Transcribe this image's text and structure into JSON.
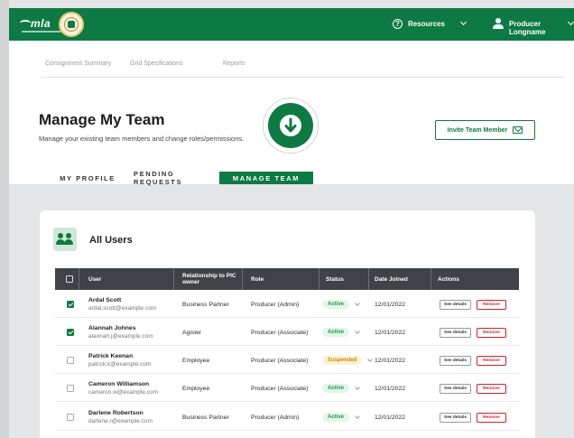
{
  "header": {
    "logo_text": "mla",
    "resources_label": "Resources",
    "user_label": "Producer Longname"
  },
  "subnav": {
    "items": [
      "Consignment Summary",
      "Grid Specifications",
      "Reports"
    ]
  },
  "page": {
    "title": "Manage My Team",
    "subtitle": "Manage your existing team members and change roles/permissions.",
    "invite_label": "Invite Team Member"
  },
  "tabs": [
    {
      "label": "MY PROFILE",
      "active": false
    },
    {
      "label": "PENDING REQUESTS",
      "active": false
    },
    {
      "label": "MANAGE TEAM",
      "active": true
    }
  ],
  "card": {
    "title": "All Users"
  },
  "table": {
    "columns": [
      "User",
      "Relationship to PIC owner",
      "Role",
      "Status",
      "Date Joined",
      "Actions"
    ],
    "see_details_label": "See details",
    "remove_label": "Remove",
    "rows": [
      {
        "name": "Ardal Scott",
        "email": "ardal.scott@example.com",
        "relationship": "Business Partner",
        "role": "Producer (Admin)",
        "status": "Active",
        "date": "12/01/2022",
        "checked": true
      },
      {
        "name": "Alannah Johnes",
        "email": "alannah.j@example.com",
        "relationship": "Agister",
        "role": "Producer (Associate)",
        "status": "Active",
        "date": "12/01/2022",
        "checked": true
      },
      {
        "name": "Patrick Keenan",
        "email": "patrick.k@example.com",
        "relationship": "Employee",
        "role": "Producer (Associate)",
        "status": "Suspended",
        "date": "12/01/2022",
        "checked": false
      },
      {
        "name": "Cameron Williamson",
        "email": "cameron.w@example.com",
        "relationship": "Employee",
        "role": "Producer (Associate)",
        "status": "Active",
        "date": "12/01/2022",
        "checked": false
      },
      {
        "name": "Darlene Robertson",
        "email": "darlene.r@example.com",
        "relationship": "Business Partner",
        "role": "Producer (Admin)",
        "status": "Active",
        "date": "12/01/2022",
        "checked": false
      }
    ]
  },
  "colors": {
    "brand_green": "#0e7a43",
    "table_header": "#3f4246",
    "remove_red": "#d2232a",
    "suspended_amber": "#c78a0a"
  },
  "icons": [
    "help-icon",
    "chevron-down-icon",
    "user-icon",
    "down-arrow-icon",
    "mail-icon",
    "users-icon",
    "checkbox-icon"
  ]
}
